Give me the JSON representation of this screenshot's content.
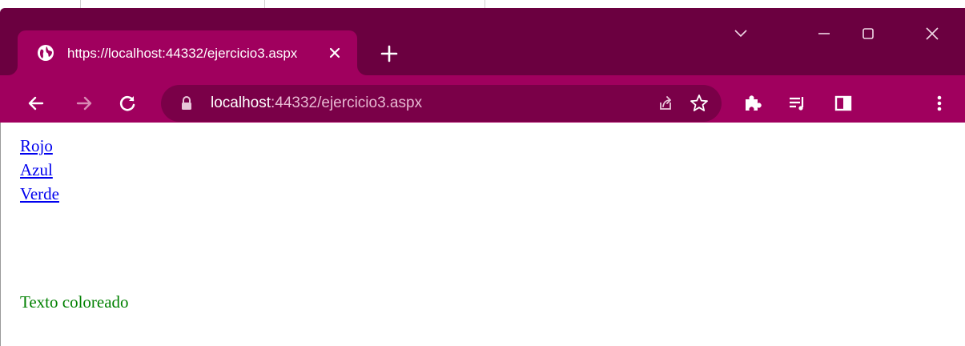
{
  "browser": {
    "tab": {
      "title": "https://localhost:44332/ejercicio3.aspx",
      "favicon": "globe-icon",
      "close_icon": "close-icon"
    },
    "new_tab_icon": "plus-icon",
    "window_controls": [
      "chevron-down-icon",
      "minimize-icon",
      "maximize-icon",
      "close-icon"
    ],
    "toolbar": {
      "nav_icons": [
        "back-arrow-icon",
        "forward-arrow-icon",
        "reload-icon"
      ],
      "address": {
        "host": "localhost",
        "path": ":44332/ejercicio3.aspx",
        "security_icon": "lock-icon"
      },
      "address_action_icons": [
        "share-icon",
        "star-icon"
      ],
      "extension_icons": [
        "puzzle-icon",
        "reading-list-icon",
        "side-panel-icon",
        "menu-dots-icon"
      ]
    },
    "colors": {
      "frame": "#6b0040",
      "toolbar": "#a0005e",
      "omnibox": "#7a0048"
    }
  },
  "page": {
    "links": [
      "Rojo",
      "Azul",
      "Verde"
    ],
    "colored_text": "Texto coloreado",
    "link_color": "#0000ee",
    "text_color": "#008000"
  }
}
